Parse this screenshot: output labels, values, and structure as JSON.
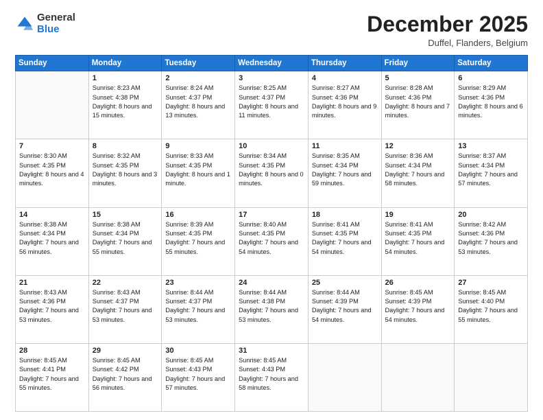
{
  "header": {
    "logo_general": "General",
    "logo_blue": "Blue",
    "month_title": "December 2025",
    "location": "Duffel, Flanders, Belgium"
  },
  "days_of_week": [
    "Sunday",
    "Monday",
    "Tuesday",
    "Wednesday",
    "Thursday",
    "Friday",
    "Saturday"
  ],
  "weeks": [
    [
      {
        "day": "",
        "info": ""
      },
      {
        "day": "1",
        "info": "Sunrise: 8:23 AM\nSunset: 4:38 PM\nDaylight: 8 hours\nand 15 minutes."
      },
      {
        "day": "2",
        "info": "Sunrise: 8:24 AM\nSunset: 4:37 PM\nDaylight: 8 hours\nand 13 minutes."
      },
      {
        "day": "3",
        "info": "Sunrise: 8:25 AM\nSunset: 4:37 PM\nDaylight: 8 hours\nand 11 minutes."
      },
      {
        "day": "4",
        "info": "Sunrise: 8:27 AM\nSunset: 4:36 PM\nDaylight: 8 hours\nand 9 minutes."
      },
      {
        "day": "5",
        "info": "Sunrise: 8:28 AM\nSunset: 4:36 PM\nDaylight: 8 hours\nand 7 minutes."
      },
      {
        "day": "6",
        "info": "Sunrise: 8:29 AM\nSunset: 4:36 PM\nDaylight: 8 hours\nand 6 minutes."
      }
    ],
    [
      {
        "day": "7",
        "info": "Sunrise: 8:30 AM\nSunset: 4:35 PM\nDaylight: 8 hours\nand 4 minutes."
      },
      {
        "day": "8",
        "info": "Sunrise: 8:32 AM\nSunset: 4:35 PM\nDaylight: 8 hours\nand 3 minutes."
      },
      {
        "day": "9",
        "info": "Sunrise: 8:33 AM\nSunset: 4:35 PM\nDaylight: 8 hours\nand 1 minute."
      },
      {
        "day": "10",
        "info": "Sunrise: 8:34 AM\nSunset: 4:35 PM\nDaylight: 8 hours\nand 0 minutes."
      },
      {
        "day": "11",
        "info": "Sunrise: 8:35 AM\nSunset: 4:34 PM\nDaylight: 7 hours\nand 59 minutes."
      },
      {
        "day": "12",
        "info": "Sunrise: 8:36 AM\nSunset: 4:34 PM\nDaylight: 7 hours\nand 58 minutes."
      },
      {
        "day": "13",
        "info": "Sunrise: 8:37 AM\nSunset: 4:34 PM\nDaylight: 7 hours\nand 57 minutes."
      }
    ],
    [
      {
        "day": "14",
        "info": "Sunrise: 8:38 AM\nSunset: 4:34 PM\nDaylight: 7 hours\nand 56 minutes."
      },
      {
        "day": "15",
        "info": "Sunrise: 8:38 AM\nSunset: 4:34 PM\nDaylight: 7 hours\nand 55 minutes."
      },
      {
        "day": "16",
        "info": "Sunrise: 8:39 AM\nSunset: 4:35 PM\nDaylight: 7 hours\nand 55 minutes."
      },
      {
        "day": "17",
        "info": "Sunrise: 8:40 AM\nSunset: 4:35 PM\nDaylight: 7 hours\nand 54 minutes."
      },
      {
        "day": "18",
        "info": "Sunrise: 8:41 AM\nSunset: 4:35 PM\nDaylight: 7 hours\nand 54 minutes."
      },
      {
        "day": "19",
        "info": "Sunrise: 8:41 AM\nSunset: 4:35 PM\nDaylight: 7 hours\nand 54 minutes."
      },
      {
        "day": "20",
        "info": "Sunrise: 8:42 AM\nSunset: 4:36 PM\nDaylight: 7 hours\nand 53 minutes."
      }
    ],
    [
      {
        "day": "21",
        "info": "Sunrise: 8:43 AM\nSunset: 4:36 PM\nDaylight: 7 hours\nand 53 minutes."
      },
      {
        "day": "22",
        "info": "Sunrise: 8:43 AM\nSunset: 4:37 PM\nDaylight: 7 hours\nand 53 minutes."
      },
      {
        "day": "23",
        "info": "Sunrise: 8:44 AM\nSunset: 4:37 PM\nDaylight: 7 hours\nand 53 minutes."
      },
      {
        "day": "24",
        "info": "Sunrise: 8:44 AM\nSunset: 4:38 PM\nDaylight: 7 hours\nand 53 minutes."
      },
      {
        "day": "25",
        "info": "Sunrise: 8:44 AM\nSunset: 4:39 PM\nDaylight: 7 hours\nand 54 minutes."
      },
      {
        "day": "26",
        "info": "Sunrise: 8:45 AM\nSunset: 4:39 PM\nDaylight: 7 hours\nand 54 minutes."
      },
      {
        "day": "27",
        "info": "Sunrise: 8:45 AM\nSunset: 4:40 PM\nDaylight: 7 hours\nand 55 minutes."
      }
    ],
    [
      {
        "day": "28",
        "info": "Sunrise: 8:45 AM\nSunset: 4:41 PM\nDaylight: 7 hours\nand 55 minutes."
      },
      {
        "day": "29",
        "info": "Sunrise: 8:45 AM\nSunset: 4:42 PM\nDaylight: 7 hours\nand 56 minutes."
      },
      {
        "day": "30",
        "info": "Sunrise: 8:45 AM\nSunset: 4:43 PM\nDaylight: 7 hours\nand 57 minutes."
      },
      {
        "day": "31",
        "info": "Sunrise: 8:45 AM\nSunset: 4:43 PM\nDaylight: 7 hours\nand 58 minutes."
      },
      {
        "day": "",
        "info": ""
      },
      {
        "day": "",
        "info": ""
      },
      {
        "day": "",
        "info": ""
      }
    ]
  ]
}
